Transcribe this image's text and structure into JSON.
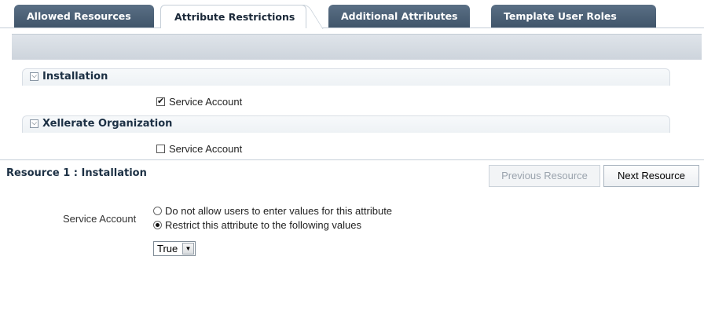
{
  "tabs": [
    {
      "label": "Allowed Resources"
    },
    {
      "label": "Attribute Restrictions"
    },
    {
      "label": "Additional Attributes"
    },
    {
      "label": "Template User Roles"
    }
  ],
  "sections": [
    {
      "title": "Installation",
      "checkbox_label": "Service Account",
      "checked": true
    },
    {
      "title": "Xellerate Organization",
      "checkbox_label": "Service Account",
      "checked": false
    }
  ],
  "resource": {
    "title": "Resource 1 : Installation",
    "previous_label": "Previous Resource",
    "next_label": "Next Resource",
    "field_label": "Service Account",
    "options": [
      {
        "label": "Do not allow users to enter values for this attribute",
        "selected": false
      },
      {
        "label": "Restrict this attribute to the following values",
        "selected": true
      }
    ],
    "select_value": "True"
  },
  "icons": {
    "disclose": "chevron-down-icon",
    "dropdown": "dropdown-arrow-icon"
  }
}
